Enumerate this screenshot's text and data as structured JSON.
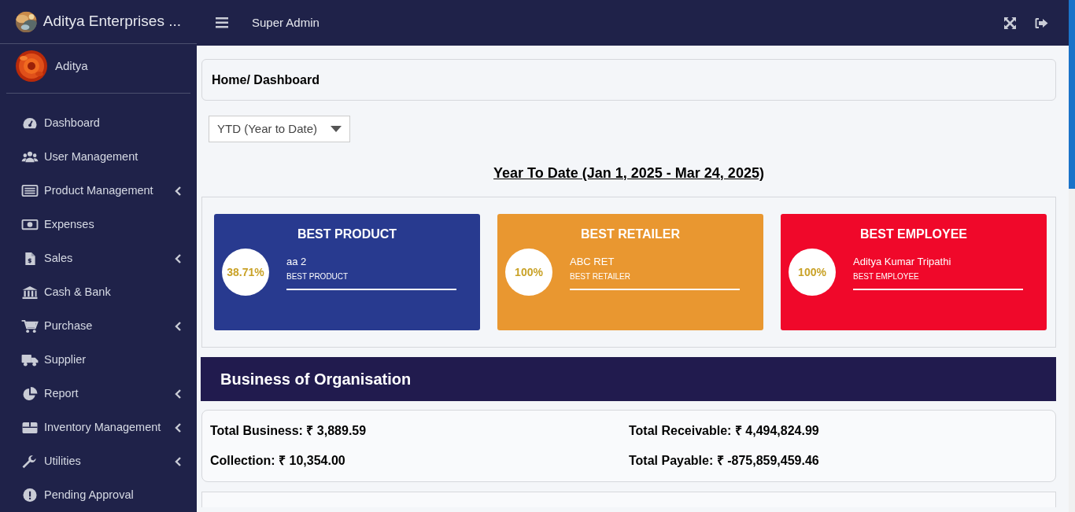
{
  "brand": {
    "name": "Aditya Enterprises ..."
  },
  "user": {
    "name": "Aditya"
  },
  "topbar": {
    "role": "Super Admin"
  },
  "sidebar": {
    "items": [
      {
        "label": "Dashboard",
        "has_submenu": false
      },
      {
        "label": "User Management",
        "has_submenu": false
      },
      {
        "label": "Product Management",
        "has_submenu": true
      },
      {
        "label": "Expenses",
        "has_submenu": false
      },
      {
        "label": "Sales",
        "has_submenu": true
      },
      {
        "label": "Cash & Bank",
        "has_submenu": false
      },
      {
        "label": "Purchase",
        "has_submenu": true
      },
      {
        "label": "Supplier",
        "has_submenu": false
      },
      {
        "label": "Report",
        "has_submenu": true
      },
      {
        "label": "Inventory Management",
        "has_submenu": true
      },
      {
        "label": "Utilities",
        "has_submenu": true
      },
      {
        "label": "Pending Approval",
        "has_submenu": false
      }
    ]
  },
  "breadcrumb": "Home/ Dashboard",
  "period_select": {
    "value": "YTD (Year to Date)"
  },
  "period_heading": "Year To Date (Jan 1, 2025 - Mar 24, 2025)",
  "best_cards": [
    {
      "title": "BEST PRODUCT",
      "percent": "38.71%",
      "name": "aa 2",
      "caption": "BEST PRODUCT",
      "color": "#283a8f"
    },
    {
      "title": "BEST RETAILER",
      "percent": "100%",
      "name": "ABC RET",
      "caption": "BEST RETAILER",
      "color": "#e99730"
    },
    {
      "title": "BEST EMPLOYEE",
      "percent": "100%",
      "name": "Aditya Kumar Tripathi",
      "caption": "BEST EMPLOYEE",
      "color": "#f0082a"
    }
  ],
  "business": {
    "title": "Business of Organisation",
    "stats": [
      {
        "label": "Total Business:",
        "value": "₹ 3,889.59"
      },
      {
        "label": "Total Receivable:",
        "value": "₹ 4,494,824.99"
      },
      {
        "label": "Collection:",
        "value": "₹ 10,354.00"
      },
      {
        "label": "Total Payable:",
        "value": "₹ -875,859,459.46"
      }
    ]
  }
}
